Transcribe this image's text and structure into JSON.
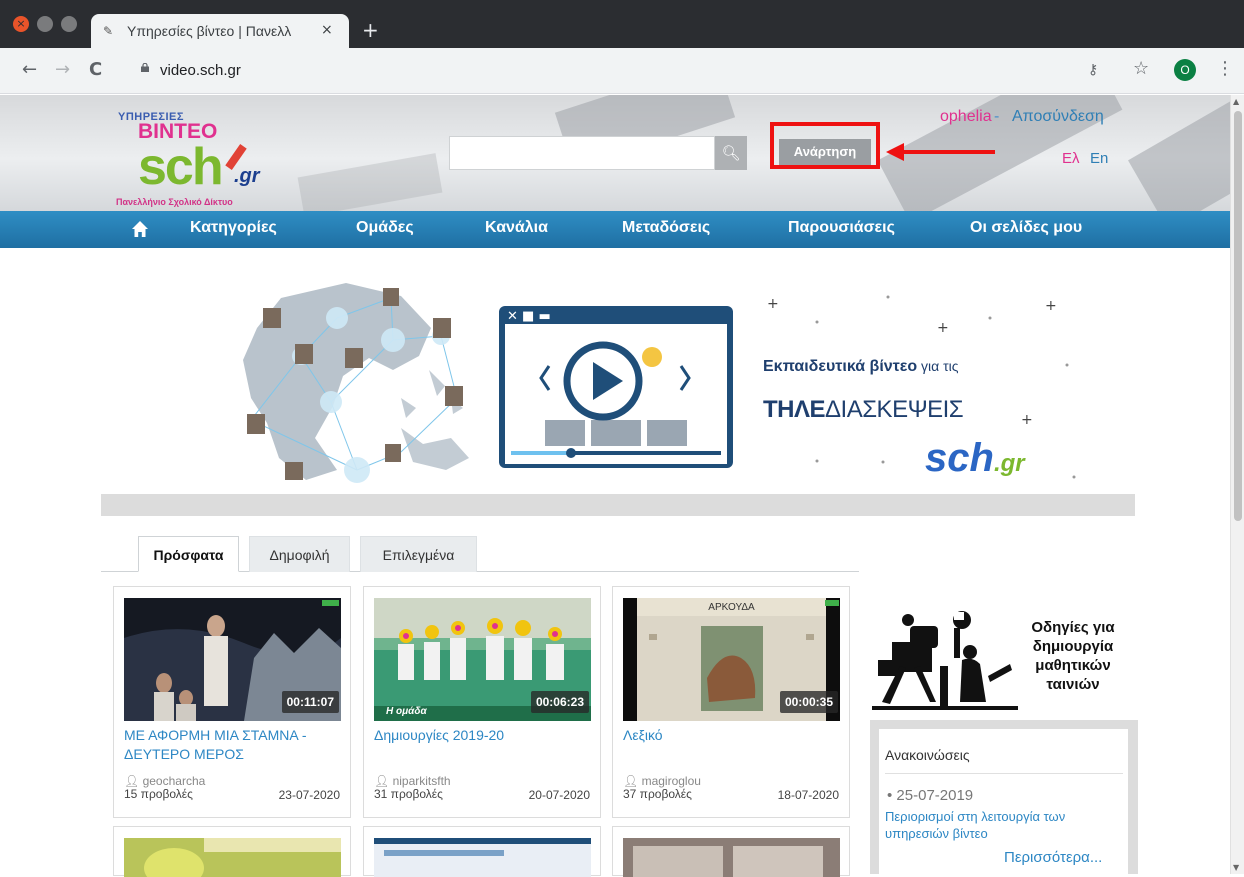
{
  "browser": {
    "tab_title": "Υπηρεσίες βίντεο | Πανελλ",
    "tab_close": "×",
    "new_tab": "+",
    "url": "video.sch.gr",
    "profile_initial": "O",
    "back": "←",
    "forward": "→",
    "reload": "C",
    "key": "⚷",
    "star": "☆",
    "menu": "⋮"
  },
  "logo": {
    "top": "ΥΠΗΡΕΣΙΕΣ",
    "brand": "ΒΙΝΤΕΟ",
    "sch": "sch",
    "gr": ".gr",
    "subtitle": "Πανελλήνιο Σχολικό Δίκτυο"
  },
  "header": {
    "search_placeholder": "",
    "upload_label": "Ανάρτηση",
    "user_name": "ophelia",
    "separator": " - ",
    "logout": "Αποσύνδεση",
    "lang_el": "Ελ",
    "lang_en": "En"
  },
  "nav": {
    "items": [
      "Κατηγορίες",
      "Ομάδες",
      "Κανάλια",
      "Μεταδόσεις",
      "Παρουσιάσεις",
      "Οι σελίδες μου"
    ]
  },
  "banner": {
    "heading_bold": "Εκπαιδευτικά βίντεο",
    "heading_rest": " για τις",
    "tele_bold": "ΤΗΛΕ",
    "tele_rest": "ΔΙΑΣΚΕΨΕΙΣ",
    "sch_logo": "sch",
    "sch_gr": ".gr"
  },
  "tabs": [
    "Πρόσφατα",
    "Δημοφιλή",
    "Επιλεγμένα"
  ],
  "videos": [
    {
      "title": "ΜΕ ΑΦΟΡΜΗ ΜΙΑ ΣΤΑΜΝΑ - ΔΕΥΤΕΡΟ ΜΕΡΟΣ",
      "duration": "00:11:07",
      "author": "geocharcha",
      "views": "15 προβολές",
      "date": "23-07-2020"
    },
    {
      "title": "Δημιουργίες 2019-20",
      "duration": "00:06:23",
      "author": "niparkitsfth",
      "views": "31 προβολές",
      "date": "20-07-2020",
      "thumb_caption": "Η ομάδα"
    },
    {
      "title": "Λεξικό",
      "duration": "00:00:35",
      "author": "magiroglou",
      "views": "37 προβολές",
      "date": "18-07-2020",
      "thumb_caption": "ΑΡΚΟΥΔΑ"
    }
  ],
  "sidebar": {
    "guide_text": "Οδηγίες για δημιουργία μαθητικών ταινιών",
    "announcements_title": "Ανακοινώσεις",
    "ann_date": "• 25-07-2019",
    "ann_text": "Περιορισμοί στη λειτουργία των υπηρεσιών βίντεο",
    "ann_more": "Περισσότερα..."
  },
  "colors": {
    "nav_blue": "#2480b8",
    "link_blue": "#2d87c4",
    "highlight_red": "#ee1111",
    "brand_pink": "#e0318f",
    "brand_green": "#7cb82f"
  }
}
